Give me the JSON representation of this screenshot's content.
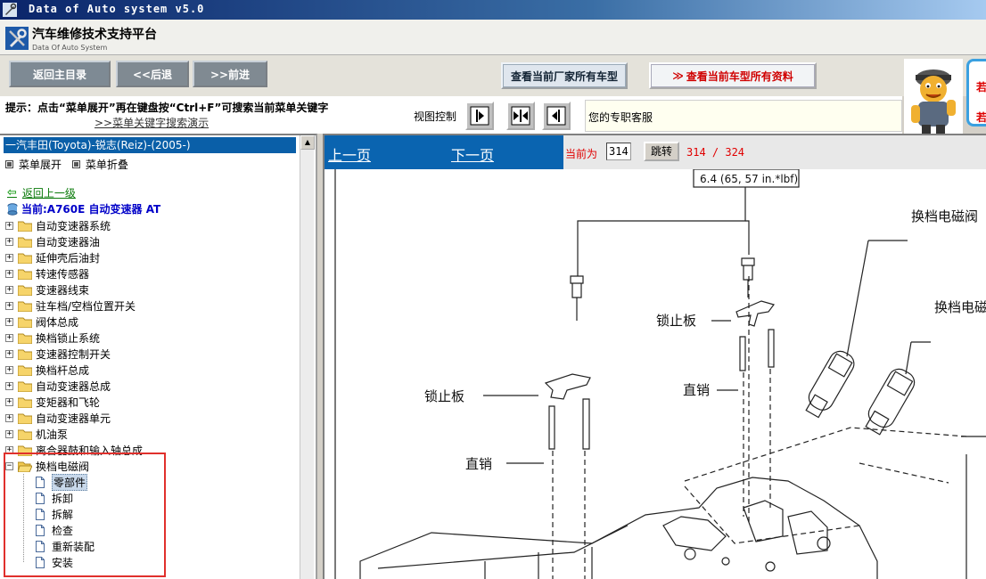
{
  "window": {
    "title": "Data of Auto system v5.0"
  },
  "header": {
    "title": "汽车维修技术支持平台",
    "subtitle": "Data Of Auto System"
  },
  "toolbar": {
    "main_menu": "返回主目录",
    "back": "<<后退",
    "forward": ">>前进",
    "all_models": "查看当前厂家所有车型",
    "all_data_arrows": "≫",
    "all_data": "查看当前车型所有资料"
  },
  "side_badge": {
    "top": "若",
    "bottom": "若"
  },
  "hint": {
    "text": "提示：点击“菜单展开”再在键盘按“Ctrl+F”可搜索当前菜单关键字",
    "demo_link": ">>菜单关键字搜索演示",
    "view_control": "视图控制",
    "service": "您的专职客服"
  },
  "tree": {
    "vehicle": "一汽丰田(Toyota)-锐志(Reiz)-(2005-)",
    "expand": "菜单展开",
    "collapse": "菜单折叠",
    "back_up": "返回上一级",
    "current": "当前:A760E 自动变速器 AT",
    "folders": [
      "自动变速器系统",
      "自动变速器油",
      "延伸壳后油封",
      "转速传感器",
      "变速器线束",
      "驻车档/空档位置开关",
      "阀体总成",
      "换档锁止系统",
      "变速器控制开关",
      "换档杆总成",
      "自动变速器总成",
      "变矩器和飞轮",
      "自动变速器单元",
      "机油泵",
      "离合器鼓和输入轴总成"
    ],
    "open_folder": "换档电磁阀",
    "leaves": [
      "零部件",
      "拆卸",
      "拆解",
      "检查",
      "重新装配",
      "安装"
    ],
    "selected_leaf": "零部件"
  },
  "pager": {
    "prev": "上一页",
    "next": "下一页",
    "current_label": "当前为",
    "page_value": "314",
    "jump": "跳转",
    "count": "314 / 324"
  },
  "diagram": {
    "torque": "6.4 (65, 57 in.*lbf)",
    "lock_plate_right": "锁止板",
    "lock_plate_left": "锁止板",
    "pin_right": "直销",
    "pin_left": "直销",
    "solenoid_1": "换档电磁阀",
    "solenoid_2": "换档电磁"
  }
}
